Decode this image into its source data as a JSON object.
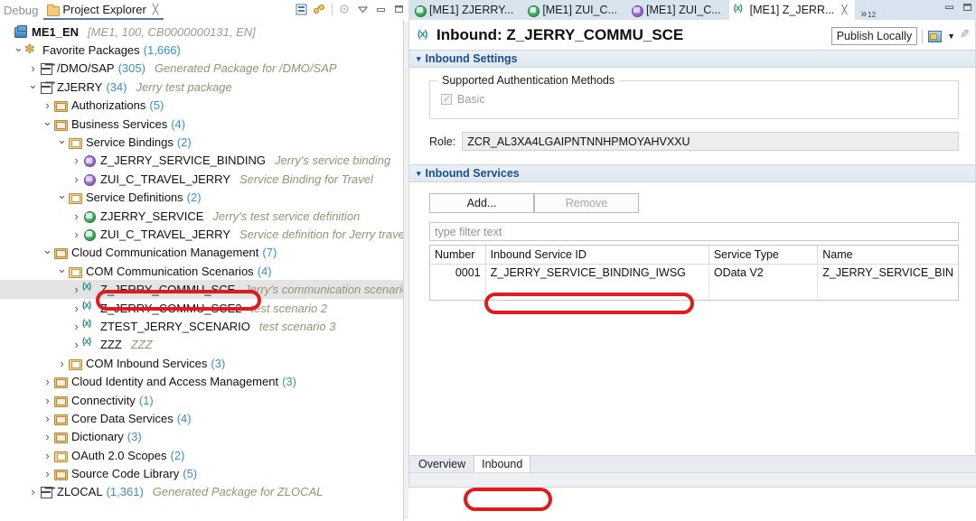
{
  "left_panel": {
    "view_tabs": [
      {
        "label": "Debug",
        "active": false,
        "icon": "none"
      },
      {
        "label": "Project Explorer",
        "active": true,
        "icon": "folder-icon",
        "close_glyph": "╳"
      }
    ],
    "toolbar_icons": [
      "collapse-all-icon",
      "link-with-editor-icon",
      "focus-on-active-task-icon",
      "view-menu-icon",
      "minimize-icon",
      "maximize-icon"
    ],
    "tree": [
      {
        "indent": 0,
        "twist": "none",
        "icon": "abap-connection-icon",
        "label": "ME1_EN",
        "desc": "[ME1, 100, CB0000000131, EN]",
        "desc_style": "grey",
        "count": "",
        "bold": true,
        "selected": false
      },
      {
        "indent": 1,
        "twist": "open",
        "icon": "favorite-packages-icon",
        "label": "Favorite Packages",
        "count": "(1,666)",
        "desc": "",
        "selected": false
      },
      {
        "indent": 2,
        "twist": "closed",
        "icon": "package-icon",
        "label": "/DMO/SAP",
        "count": "(305)",
        "desc": "Generated Package for /DMO/SAP",
        "selected": false
      },
      {
        "indent": 2,
        "twist": "open",
        "icon": "package-icon",
        "label": "ZJERRY",
        "count": "(34)",
        "desc": "Jerry test package",
        "selected": false
      },
      {
        "indent": 3,
        "twist": "closed",
        "icon": "folder-icon",
        "label": "Authorizations",
        "count": "(5)",
        "desc": "",
        "selected": false
      },
      {
        "indent": 3,
        "twist": "open",
        "icon": "folder-icon",
        "label": "Business Services",
        "count": "(4)",
        "desc": "",
        "selected": false
      },
      {
        "indent": 4,
        "twist": "open",
        "icon": "folder-open-icon",
        "label": "Service Bindings",
        "count": "(2)",
        "desc": "",
        "selected": false
      },
      {
        "indent": 5,
        "twist": "closed",
        "icon": "service-binding-icon",
        "label": "Z_JERRY_SERVICE_BINDING",
        "count": "",
        "desc": "Jerry's service binding",
        "selected": false
      },
      {
        "indent": 5,
        "twist": "closed",
        "icon": "service-binding-icon",
        "label": "ZUI_C_TRAVEL_JERRY",
        "count": "",
        "desc": "Service Binding for Travel",
        "selected": false
      },
      {
        "indent": 4,
        "twist": "open",
        "icon": "folder-open-icon",
        "label": "Service Definitions",
        "count": "(2)",
        "desc": "",
        "selected": false
      },
      {
        "indent": 5,
        "twist": "closed",
        "icon": "service-definition-icon",
        "label": "ZJERRY_SERVICE",
        "count": "",
        "desc": "Jerry's test service definition",
        "selected": false
      },
      {
        "indent": 5,
        "twist": "closed",
        "icon": "service-definition-icon",
        "label": "ZUI_C_TRAVEL_JERRY",
        "count": "",
        "desc": "Service definition for Jerry travel",
        "selected": false
      },
      {
        "indent": 3,
        "twist": "open",
        "icon": "folder-icon",
        "label": "Cloud Communication Management",
        "count": "(7)",
        "desc": "",
        "selected": false
      },
      {
        "indent": 4,
        "twist": "open",
        "icon": "folder-open-icon",
        "label": "COM Communication Scenarios",
        "count": "(4)",
        "desc": "",
        "selected": false
      },
      {
        "indent": 5,
        "twist": "closed",
        "icon": "comm-scenario-icon",
        "label": "Z_JERRY_COMMU_SCE",
        "count": "",
        "desc": "Jerry's communication scenario",
        "selected": true
      },
      {
        "indent": 5,
        "twist": "closed",
        "icon": "comm-scenario-icon",
        "label": "Z_JERRY_COMMU_SCE2",
        "count": "",
        "desc": "test scenario 2",
        "selected": false
      },
      {
        "indent": 5,
        "twist": "closed",
        "icon": "comm-scenario-icon",
        "label": "ZTEST_JERRY_SCENARIO",
        "count": "",
        "desc": "test scenario 3",
        "selected": false
      },
      {
        "indent": 5,
        "twist": "closed",
        "icon": "comm-scenario-icon",
        "label": "ZZZ",
        "count": "",
        "desc": "ZZZ",
        "selected": false
      },
      {
        "indent": 4,
        "twist": "closed",
        "icon": "folder-open-icon",
        "label": "COM Inbound Services",
        "count": "(3)",
        "desc": "",
        "selected": false
      },
      {
        "indent": 3,
        "twist": "closed",
        "icon": "folder-icon",
        "label": "Cloud Identity and Access Management",
        "count": "(3)",
        "desc": "",
        "selected": false
      },
      {
        "indent": 3,
        "twist": "closed",
        "icon": "folder-icon",
        "label": "Connectivity",
        "count": "(1)",
        "desc": "",
        "selected": false
      },
      {
        "indent": 3,
        "twist": "closed",
        "icon": "folder-icon",
        "label": "Core Data Services",
        "count": "(4)",
        "desc": "",
        "selected": false
      },
      {
        "indent": 3,
        "twist": "closed",
        "icon": "folder-icon",
        "label": "Dictionary",
        "count": "(3)",
        "desc": "",
        "selected": false
      },
      {
        "indent": 3,
        "twist": "closed",
        "icon": "folder-open-icon",
        "label": "OAuth 2.0 Scopes",
        "count": "(2)",
        "desc": "",
        "selected": false
      },
      {
        "indent": 3,
        "twist": "closed",
        "icon": "folder-icon",
        "label": "Source Code Library",
        "count": "(5)",
        "desc": "",
        "selected": false
      },
      {
        "indent": 2,
        "twist": "closed",
        "icon": "package-icon",
        "label": "ZLOCAL",
        "count": "(1,361)",
        "desc": "Generated Package for ZLOCAL",
        "selected": false
      }
    ]
  },
  "editor": {
    "tabs": [
      {
        "label": "[ME1] ZJERRY...",
        "icon": "service-definition-icon",
        "active": false,
        "closable": false
      },
      {
        "label": "[ME1] ZUI_C...",
        "icon": "service-definition-icon",
        "active": false,
        "closable": false
      },
      {
        "label": "[ME1] ZUI_C...",
        "icon": "service-binding-icon",
        "active": false,
        "closable": false
      },
      {
        "label": "[ME1] Z_JERR...",
        "icon": "comm-scenario-icon",
        "active": true,
        "closable": true,
        "close_glyph": "╳"
      }
    ],
    "overflow": {
      "chevron": "»",
      "count": "12"
    },
    "window_controls": [
      "minimize-icon",
      "maximize-icon"
    ],
    "header": {
      "icon": "comm-scenario-icon",
      "title": "Inbound: Z_JERRY_COMMU_SCE",
      "publish_button": "Publish Locally",
      "action_icons": [
        "screenshot-icon",
        "dropdown-caret-icon",
        "edit-icon"
      ]
    },
    "inbound_settings": {
      "section_title": "Inbound Settings",
      "twisty": "▾",
      "auth_group_label": "Supported Authentication Methods",
      "auth_methods": [
        {
          "label": "Basic",
          "checked": true,
          "disabled": true
        }
      ],
      "role_label": "Role:",
      "role_value": "ZCR_AL3XA4LGAIPNTNNHPMOYAHVXXU"
    },
    "inbound_services": {
      "section_title": "Inbound Services",
      "twisty": "▾",
      "add_button": "Add...",
      "remove_button": "Remove",
      "filter_placeholder": "type filter text",
      "columns": [
        "Number",
        "Inbound Service ID",
        "Service Type",
        "Name"
      ],
      "rows": [
        {
          "number": "0001",
          "service_id": "Z_JERRY_SERVICE_BINDING_IWSG",
          "service_type": "OData V2",
          "name": "Z_JERRY_SERVICE_BIN"
        }
      ]
    },
    "bottom_tabs": [
      {
        "label": "Overview",
        "active": false
      },
      {
        "label": "Inbound",
        "active": true
      }
    ]
  },
  "annotations": {
    "highlight_color": "#e01b1b",
    "ovals": [
      "tree-selected-node",
      "table-service-id-cell",
      "bottom-tab-inbound"
    ]
  }
}
